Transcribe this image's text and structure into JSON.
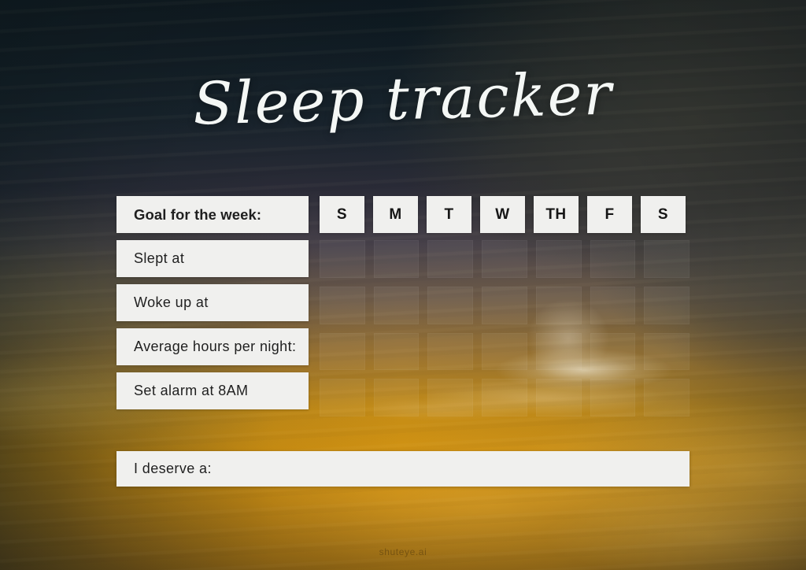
{
  "page": {
    "title": "Sleep tracker",
    "watermark": "shuteye.ai",
    "bg_top_color": "#0e1a21",
    "bg_bottom_color": "#c98c0d",
    "box_fill_color": "#f0f0ee",
    "text_color": "#1f1f1f",
    "title_color": "#f4f7f5"
  },
  "tracker": {
    "day_headers": [
      {
        "label": "S"
      },
      {
        "label": "M"
      },
      {
        "label": "T"
      },
      {
        "label": "W"
      },
      {
        "label": "TH"
      },
      {
        "label": "F"
      },
      {
        "label": "S"
      }
    ],
    "rows": [
      {
        "label": "Goal for the week:",
        "bold": true,
        "has_days": true
      },
      {
        "label": "Slept at",
        "bold": false,
        "has_days": false
      },
      {
        "label": "Woke up at",
        "bold": false,
        "has_days": false
      },
      {
        "label": "Average hours per night:",
        "bold": false,
        "has_days": false
      },
      {
        "label": "Set alarm at 8AM",
        "bold": false,
        "has_days": false
      }
    ]
  },
  "reward": {
    "label": "I deserve a:"
  },
  "grid": {
    "columns": 7,
    "rows": 4
  }
}
